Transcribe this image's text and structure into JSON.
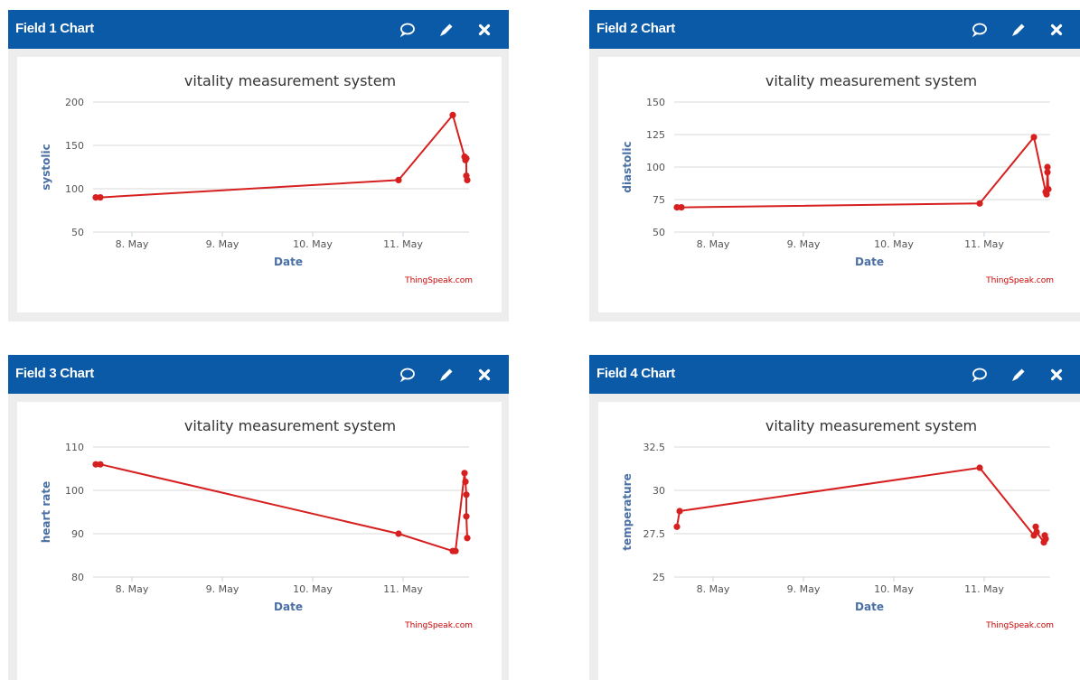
{
  "colors": {
    "header": "#0b5aa7",
    "series": "#d62020",
    "axis_title": "#4a6fa5",
    "credit": "#cc0000",
    "grid": "#d8d8d8"
  },
  "icons": [
    "comment-icon",
    "pencil-icon",
    "close-icon"
  ],
  "panels": [
    {
      "title": "Field 1 Chart"
    },
    {
      "title": "Field 2 Chart"
    },
    {
      "title": "Field 3 Chart"
    },
    {
      "title": "Field 4 Chart"
    }
  ],
  "chart_data": [
    {
      "type": "line",
      "title": "vitality measurement system",
      "xlabel": "Date",
      "ylabel": "systolic",
      "credit": "ThingSpeak.com",
      "x_ticks": [
        "8. May",
        "9. May",
        "10. May",
        "11. May"
      ],
      "x_range": [
        7.57,
        11.73
      ],
      "ylim": [
        50,
        200
      ],
      "y_ticks": [
        "50",
        "100",
        "150",
        "200"
      ],
      "grid": true,
      "series": [
        {
          "x": [
            7.6,
            7.65,
            10.95,
            11.55,
            11.68,
            11.69,
            11.7,
            11.7,
            11.71
          ],
          "y": [
            90,
            90,
            110,
            185,
            137,
            133,
            135,
            115,
            110
          ]
        }
      ]
    },
    {
      "type": "line",
      "title": "vitality measurement system",
      "xlabel": "Date",
      "ylabel": "diastolic",
      "credit": "ThingSpeak.com",
      "x_ticks": [
        "8. May",
        "9. May",
        "10. May",
        "11. May"
      ],
      "x_range": [
        7.57,
        11.73
      ],
      "ylim": [
        50,
        150
      ],
      "y_ticks": [
        "50",
        "75",
        "100",
        "125",
        "150"
      ],
      "grid": true,
      "series": [
        {
          "x": [
            7.6,
            7.65,
            10.95,
            11.55,
            11.68,
            11.69,
            11.7,
            11.7,
            11.71
          ],
          "y": [
            69,
            69,
            72,
            123,
            81,
            79,
            96,
            100,
            83
          ]
        }
      ]
    },
    {
      "type": "line",
      "title": "vitality measurement system",
      "xlabel": "Date",
      "ylabel": "heart rate",
      "credit": "ThingSpeak.com",
      "x_ticks": [
        "8. May",
        "9. May",
        "10. May",
        "11. May"
      ],
      "x_range": [
        7.57,
        11.73
      ],
      "ylim": [
        80,
        110
      ],
      "y_ticks": [
        "80",
        "90",
        "100",
        "110"
      ],
      "grid": true,
      "series": [
        {
          "x": [
            7.6,
            7.65,
            10.95,
            11.55,
            11.58,
            11.68,
            11.69,
            11.7,
            11.7,
            11.71
          ],
          "y": [
            106,
            106,
            90,
            86,
            86,
            104,
            102,
            99,
            94,
            89
          ]
        }
      ]
    },
    {
      "type": "line",
      "title": "vitality measurement system",
      "xlabel": "Date",
      "ylabel": "temperature",
      "credit": "ThingSpeak.com",
      "x_ticks": [
        "8. May",
        "9. May",
        "10. May",
        "11. May"
      ],
      "x_range": [
        7.57,
        11.73
      ],
      "ylim": [
        25,
        32.5
      ],
      "y_ticks": [
        "25",
        "27.5",
        "30",
        "32.5"
      ],
      "grid": true,
      "series": [
        {
          "x": [
            7.6,
            7.63,
            10.95,
            11.55,
            11.57,
            11.58,
            11.66,
            11.67,
            11.68
          ],
          "y": [
            27.9,
            28.8,
            31.3,
            27.4,
            27.9,
            27.6,
            27.0,
            27.4,
            27.2
          ]
        }
      ]
    }
  ]
}
